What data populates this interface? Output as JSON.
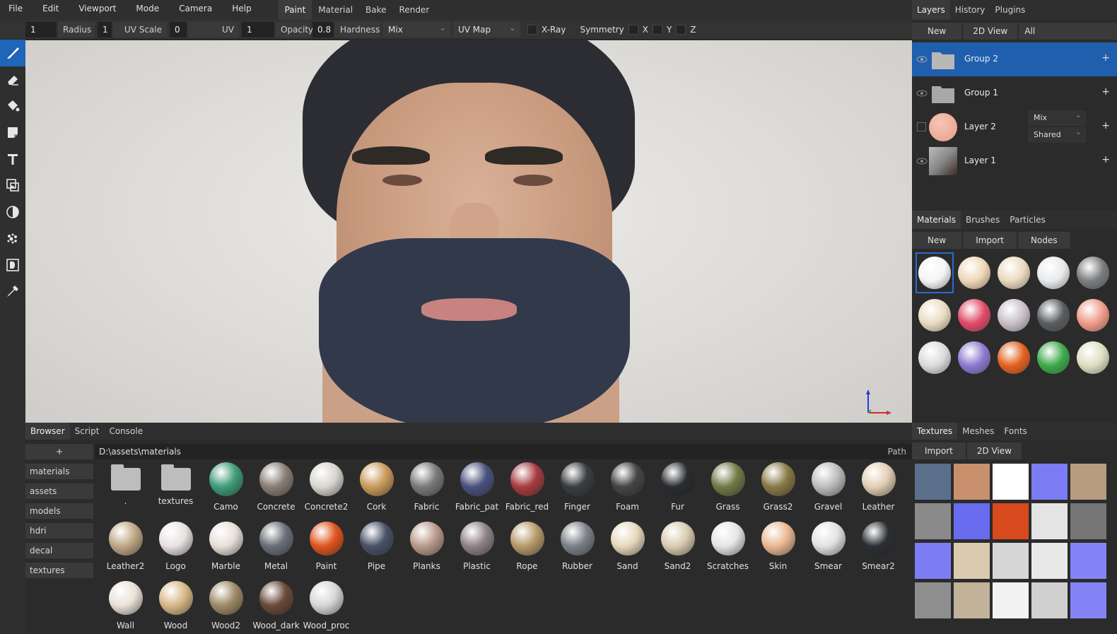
{
  "menu": [
    "File",
    "Edit",
    "Viewport",
    "Mode",
    "Camera",
    "Help"
  ],
  "workspaces": [
    {
      "label": "Paint",
      "active": true
    },
    {
      "label": "Material",
      "active": false
    },
    {
      "label": "Bake",
      "active": false
    },
    {
      "label": "Render",
      "active": false
    }
  ],
  "options": {
    "radius": {
      "value": "1",
      "label": "Radius"
    },
    "uv_scale": {
      "value": "1",
      "label": "UV Scale"
    },
    "uv_rotate": {
      "value": "0",
      "label": "UV Rotate"
    },
    "opacity": {
      "value": "1",
      "label": "Opacity"
    },
    "hardness": {
      "value": "0.8",
      "label": "Hardness"
    },
    "blend": "Mix",
    "uv_map": "UV Map",
    "xray": "X-Ray",
    "symmetry": "Symmetry",
    "axes": [
      "X",
      "Y",
      "Z"
    ]
  },
  "tools": [
    "brush-icon",
    "eraser-icon",
    "fill-icon",
    "decal-icon",
    "text-icon",
    "clone-icon",
    "blur-icon",
    "particle-icon",
    "bake-icon",
    "picker-icon"
  ],
  "browser": {
    "tabs": [
      "Browser",
      "Script",
      "Console"
    ],
    "add_label": "+",
    "folders": [
      "materials",
      "assets",
      "models",
      "hdri",
      "decal",
      "textures"
    ],
    "path": "D:\\assets\\materials",
    "path_label": "Path",
    "items": [
      {
        "name": ".",
        "kind": "folder"
      },
      {
        "name": "textures",
        "kind": "folder"
      },
      {
        "name": "Camo",
        "color": "#3e9c7a"
      },
      {
        "name": "Concrete",
        "color": "#8a7e76"
      },
      {
        "name": "Concrete2",
        "color": "#d9d5cf"
      },
      {
        "name": "Cork",
        "color": "#c99a5a"
      },
      {
        "name": "Fabric",
        "color": "#7a7a7a"
      },
      {
        "name": "Fabric_pat",
        "color": "#4a5380"
      },
      {
        "name": "Fabric_red",
        "color": "#a83c40"
      },
      {
        "name": "Finger",
        "color": "#3a3e40"
      },
      {
        "name": "Foam",
        "color": "#454545"
      },
      {
        "name": "Fur",
        "color": "#2a2c30"
      },
      {
        "name": "Grass",
        "color": "#727a48"
      },
      {
        "name": "Grass2",
        "color": "#8a7a48"
      },
      {
        "name": "Gravel",
        "color": "#bdbdbd"
      },
      {
        "name": "Leather",
        "color": "#e3cfb4"
      },
      {
        "name": "Leather2",
        "color": "#c0a786"
      },
      {
        "name": "Logo",
        "color": "#e8e2e2"
      },
      {
        "name": "Marble",
        "color": "#e6e0d8"
      },
      {
        "name": "Metal",
        "color": "#6a6f78"
      },
      {
        "name": "Paint",
        "color": "#e0551e"
      },
      {
        "name": "Pipe",
        "color": "#4a5268"
      },
      {
        "name": "Planks",
        "color": "#b89a8c"
      },
      {
        "name": "Plastic",
        "color": "#8e8286"
      },
      {
        "name": "Rope",
        "color": "#b79a6a"
      },
      {
        "name": "Rubber",
        "color": "#7c8088"
      },
      {
        "name": "Sand",
        "color": "#e6d8bc"
      },
      {
        "name": "Sand2",
        "color": "#d9ccb0"
      },
      {
        "name": "Scratches",
        "color": "#e6e6e6"
      },
      {
        "name": "Skin",
        "color": "#eab894"
      },
      {
        "name": "Smear",
        "color": "#e2e2e2"
      },
      {
        "name": "Smear2",
        "color": "#2c2f33"
      },
      {
        "name": "Wall",
        "color": "#e8e2d8"
      },
      {
        "name": "Wood",
        "color": "#d8b888"
      },
      {
        "name": "Wood2",
        "color": "#9e8a66"
      },
      {
        "name": "Wood_dark",
        "color": "#6a4a38"
      },
      {
        "name": "Wood_proc",
        "color": "#d6d6d6"
      }
    ]
  },
  "layers_panel": {
    "tabs": [
      "Layers",
      "History",
      "Plugins"
    ],
    "new_label": "New",
    "view_label": "2D View",
    "filter": "All",
    "layers": [
      {
        "name": "Group 2",
        "kind": "folder",
        "active": true
      },
      {
        "name": "Group 1",
        "kind": "folder",
        "active": false
      },
      {
        "name": "Layer 2",
        "kind": "ball",
        "active": false,
        "blend": "Mix",
        "mode": "Shared"
      },
      {
        "name": "Layer 1",
        "kind": "tex",
        "active": false
      }
    ]
  },
  "materials_panel": {
    "tabs": [
      "Materials",
      "Brushes",
      "Particles"
    ],
    "buttons": [
      "New",
      "Import",
      "Nodes"
    ],
    "swatches": [
      "#f4f4f4",
      "#efd6b8",
      "#ead9c0",
      "#e8eaec",
      "#7a7c7e",
      "#e8dcc2",
      "#e14a6a",
      "#c9bfc8",
      "#5a5d60",
      "#ee9b88",
      "#d9dadc",
      "#8c78d0",
      "#e2601e",
      "#3ea94a",
      "#ddddc2"
    ]
  },
  "textures_panel": {
    "tabs": [
      "Textures",
      "Meshes",
      "Fonts"
    ],
    "buttons": [
      "Import",
      "2D View"
    ],
    "tiles": [
      "#5a6f8c",
      "#c8906c",
      "#ffffff",
      "#7c7cf4",
      "#b79c80",
      "#8a8a8a",
      "#6a6cf0",
      "#d84a1e",
      "#e4e4e4",
      "#767676",
      "#7c7cf4",
      "#dccab0",
      "#d6d6d6",
      "#e8e8e8",
      "#8484f6",
      "#8e8e8e",
      "#c2b29a",
      "#f2f2f2",
      "#d0d0d0",
      "#8484f6"
    ]
  }
}
